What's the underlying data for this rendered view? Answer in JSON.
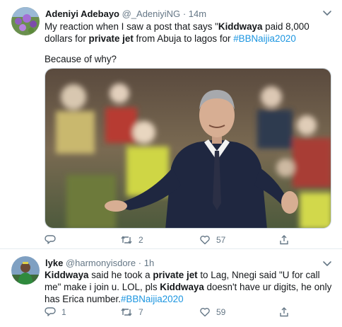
{
  "tweets": [
    {
      "author_name": "Adeniyi Adebayo",
      "handle": "@_AdeniyiNG",
      "separator": "·",
      "time": "14m",
      "text_parts": [
        "My reaction when I saw a post that says \"",
        "Kiddwaya",
        " paid 8,000 dollars for ",
        "private jet",
        " from Abuja to lagos for ",
        "#BBNaijia2020"
      ],
      "question": "Because of why?",
      "avatar_icon": "flower-field-avatar",
      "media_icon": "photo-man-shrugging-in-navy-coat",
      "actions": {
        "replies": "",
        "retweets": "2",
        "likes": "57"
      }
    },
    {
      "author_name": "lyke",
      "handle": "@harmonyisdore",
      "separator": "·",
      "time": "1h",
      "text_parts": [
        "Kiddwaya",
        " said he took a ",
        "private jet",
        " to Lag, Nnegi said \"U for call me\" make i join u. LOL, pls ",
        "Kiddwaya",
        " doesn't have ur digits, he only has Erica number.",
        "#BBNaijia2020"
      ],
      "avatar_icon": "person-photo-avatar",
      "actions": {
        "replies": "1",
        "retweets": "7",
        "likes": "59"
      }
    }
  ],
  "colors": {
    "text": "#14171a",
    "muted": "#657786",
    "link": "#1b95e0",
    "divider": "#e6ecf0"
  }
}
